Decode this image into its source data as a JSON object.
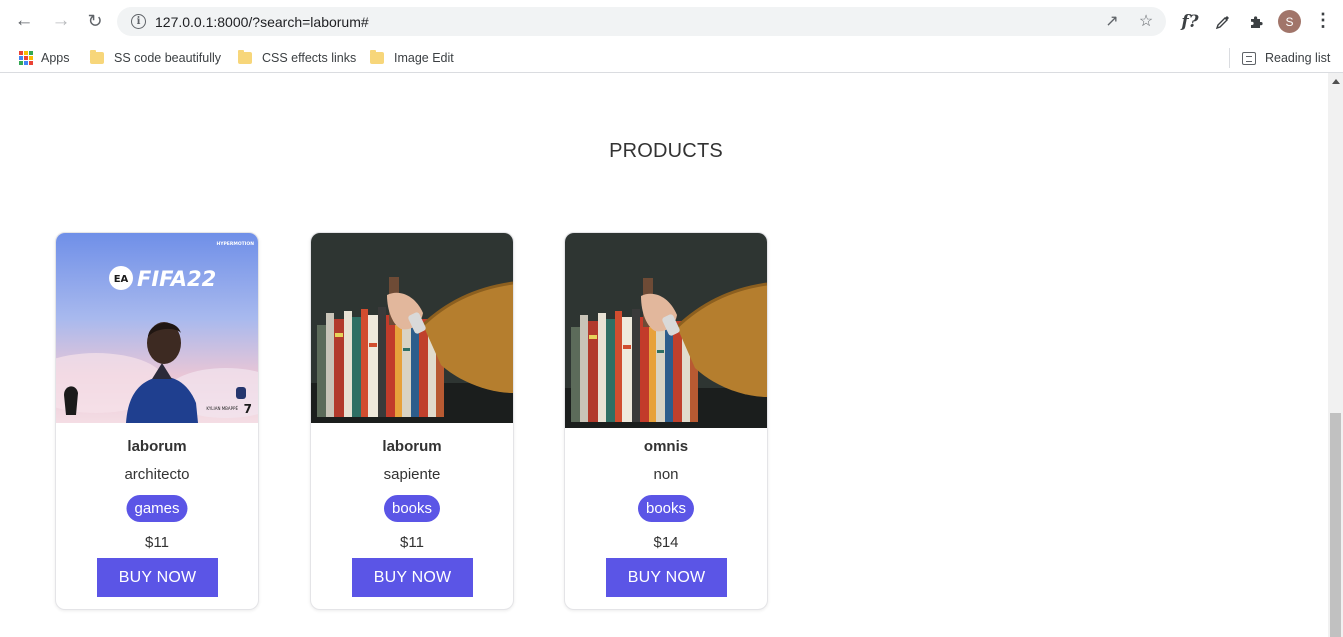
{
  "browser": {
    "url": "127.0.0.1:8000/?search=laborum#",
    "profile_initial": "S",
    "extension_fq_label": "f?",
    "bookmarks": [
      {
        "label": "Apps",
        "icon": "apps-grid-icon"
      },
      {
        "label": "SS code beautifully",
        "icon": "folder-icon"
      },
      {
        "label": "CSS effects links",
        "icon": "folder-icon"
      },
      {
        "label": "Image Edit",
        "icon": "folder-icon"
      }
    ],
    "reading_list": "Reading list",
    "icons": {
      "back": "back-arrow-icon",
      "forward": "forward-arrow-icon",
      "reload": "reload-icon",
      "info": "site-info-icon",
      "share": "share-icon",
      "star": "bookmark-star-icon",
      "eyedropper": "eyedropper-icon",
      "extensions": "puzzle-icon",
      "menu": "kebab-menu-icon"
    }
  },
  "page": {
    "title": "PRODUCTS",
    "accent_color": "#5b55e6",
    "products": [
      {
        "name": "laborum",
        "description": "architecto",
        "category": "games",
        "price": "$11",
        "button": "BUY NOW",
        "image": "fifa22-cover"
      },
      {
        "name": "laborum",
        "description": "sapiente",
        "category": "books",
        "price": "$11",
        "button": "BUY NOW",
        "image": "bookshelf-hand"
      },
      {
        "name": "omnis",
        "description": "non",
        "category": "books",
        "price": "$14",
        "button": "BUY NOW",
        "image": "bookshelf-hand"
      }
    ]
  },
  "fifa_cover": {
    "brand": "FIFA22",
    "ea_mark": "EA",
    "player_name": "KYLIAN MBAPPÉ",
    "player_number": "7",
    "publisher": "HYPERMOTION"
  }
}
